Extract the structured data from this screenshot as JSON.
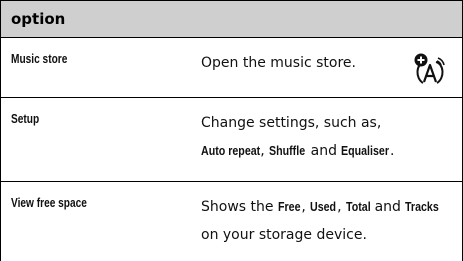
{
  "header": {
    "label": "option"
  },
  "rows": [
    {
      "option": "Music store",
      "description_lines": [
        "Open the music store."
      ],
      "icon": "network-access-icon"
    },
    {
      "option": "Setup",
      "description_line1": "Change settings, such as,",
      "description_line2": {
        "kw1": "Auto repeat",
        "sep1": ", ",
        "kw2": "Shuffle",
        "sep2": " and ",
        "kw3": "Equaliser",
        "end": "."
      }
    },
    {
      "option": "View free space",
      "description_line1": {
        "pre": "Shows the ",
        "kw1": "Free",
        "sep1": ", ",
        "kw2": "Used",
        "sep2": ", ",
        "kw3": "Total",
        "sep3": " and ",
        "kw4": "Tracks"
      },
      "description_line2": "on your storage device."
    }
  ],
  "colors": {
    "header_background": "#cfcfcf",
    "border": "#000000",
    "text": "#111111"
  }
}
